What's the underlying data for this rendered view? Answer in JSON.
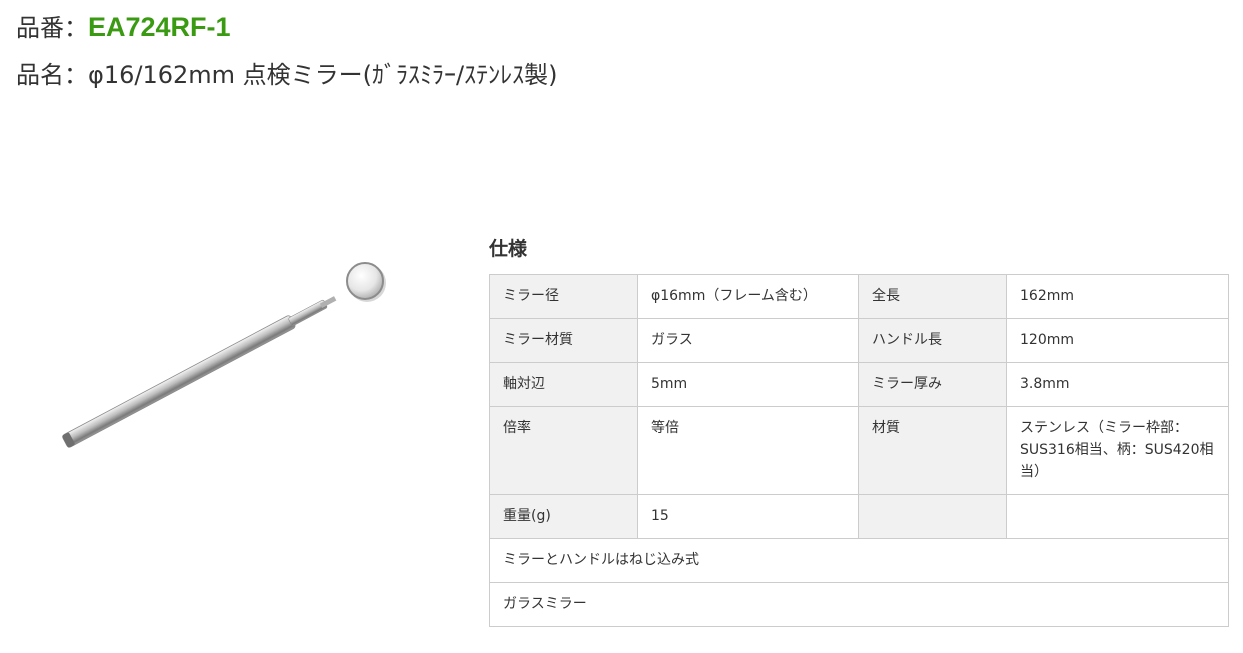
{
  "header": {
    "code_label": "品番：",
    "code_value": "EA724RF-1",
    "name_label": "品名：",
    "name_value": "φ16/162mm 点検ミラー(ｶﾞﾗｽﾐﾗｰ/ｽﾃﾝﾚｽ製)"
  },
  "image": {
    "icon": "inspection-mirror-image"
  },
  "specs": {
    "title": "仕様",
    "rows": [
      {
        "l1": "ミラー径",
        "v1": "φ16mm（フレーム含む）",
        "l2": "全長",
        "v2": "162mm"
      },
      {
        "l1": "ミラー材質",
        "v1": "ガラス",
        "l2": "ハンドル長",
        "v2": "120mm"
      },
      {
        "l1": "軸対辺",
        "v1": "5mm",
        "l2": "ミラー厚み",
        "v2": "3.8mm"
      },
      {
        "l1": "倍率",
        "v1": "等倍",
        "l2": "材質",
        "v2": "ステンレス（ミラー枠部：SUS316相当、柄：SUS420相当）"
      },
      {
        "l1": "重量(g)",
        "v1": "15",
        "l2": "",
        "v2": ""
      }
    ],
    "notes": [
      "ミラーとハンドルはねじ込み式",
      "ガラスミラー"
    ]
  }
}
